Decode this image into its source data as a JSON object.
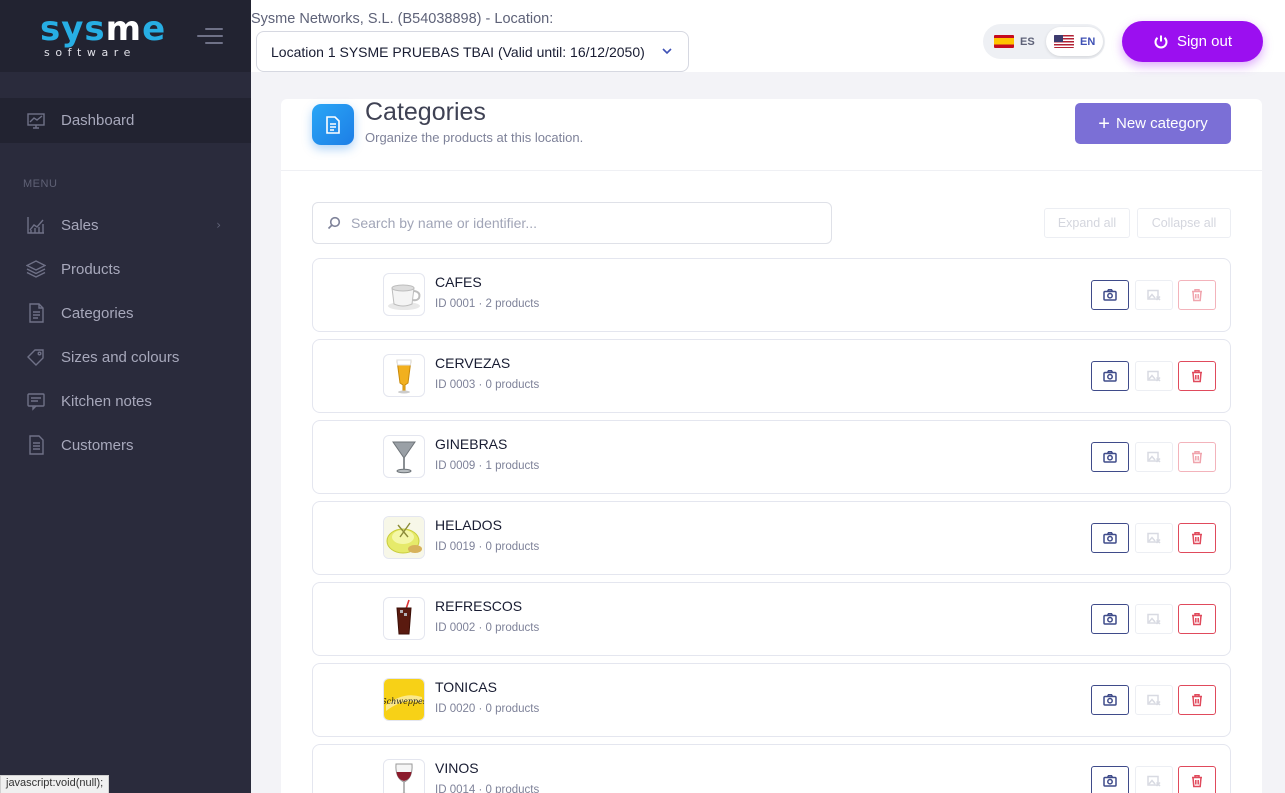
{
  "brand": {
    "logo_text_a": "sys",
    "logo_text_b": "m",
    "logo_text_c": "e",
    "logo_sub": "software"
  },
  "sidebar": {
    "dashboard": {
      "label": "Dashboard",
      "icon": "chart-line-icon"
    },
    "menu_heading": "MENU",
    "items": [
      {
        "label": "Sales",
        "icon": "trend-chart-icon",
        "has_submenu": true
      },
      {
        "label": "Products",
        "icon": "layers-icon"
      },
      {
        "label": "Categories",
        "icon": "document-icon"
      },
      {
        "label": "Sizes and colours",
        "icon": "tag-icon"
      },
      {
        "label": "Kitchen notes",
        "icon": "note-icon"
      },
      {
        "label": "Customers",
        "icon": "document-list-icon"
      }
    ]
  },
  "header": {
    "company": "Sysme Networks, S.L. (B54038898) - Location:",
    "location_value": "Location 1 SYSME PRUEBAS TBAI (Valid until: 16/12/2050)",
    "lang_es": "ES",
    "lang_en": "EN",
    "active_lang": "EN",
    "signout_label": "Sign out"
  },
  "page": {
    "title": "Categories",
    "subtitle": "Organize the products at this location.",
    "new_button": "New category",
    "search_placeholder": "Search by name or identifier...",
    "search_value": "",
    "expand_all": "Expand all",
    "collapse_all": "Collapse all"
  },
  "categories": [
    {
      "name": "CAFES",
      "meta": "ID 0001 · 2 products",
      "image": "coffee-cup",
      "delete_enabled": false
    },
    {
      "name": "CERVEZAS",
      "meta": "ID 0003 · 0 products",
      "image": "beer-glass",
      "delete_enabled": true
    },
    {
      "name": "GINEBRAS",
      "meta": "ID 0009 · 1 products",
      "image": "martini-glass",
      "delete_enabled": false
    },
    {
      "name": "HELADOS",
      "meta": "ID 0019 · 0 products",
      "image": "ice-cream",
      "delete_enabled": true
    },
    {
      "name": "REFRESCOS",
      "meta": "ID 0002 · 0 products",
      "image": "cola-glass",
      "delete_enabled": true
    },
    {
      "name": "TONICAS",
      "meta": "ID 0020 · 0 products",
      "image": "schweppes-logo",
      "image_text": "Schweppes",
      "delete_enabled": true
    },
    {
      "name": "VINOS",
      "meta": "ID 0014 · 0 products",
      "image": "wine-glass",
      "delete_enabled": true
    }
  ],
  "status_bar": "javascript:void(null);",
  "colors": {
    "sidebar_bg": "#2a2b3c",
    "brand_blue": "#27aee4",
    "signout": "#9b0ff0",
    "new_button": "#7b6fd6",
    "delete_red": "#e04a5c",
    "photo_navy": "#3f4b8a"
  }
}
